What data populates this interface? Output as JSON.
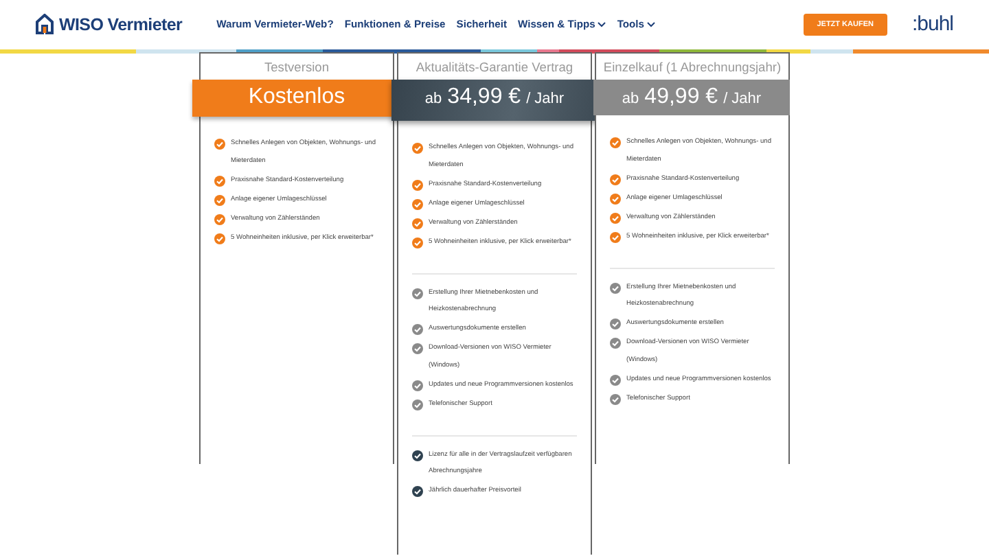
{
  "header": {
    "logo": "WISO Vermieter",
    "nav": [
      {
        "label": "Warum Vermieter-Web?",
        "dropdown": false
      },
      {
        "label": "Funktionen & Preise",
        "dropdown": false
      },
      {
        "label": "Sicherheit",
        "dropdown": false
      },
      {
        "label": "Wissen & Tipps",
        "dropdown": true
      },
      {
        "label": "Tools",
        "dropdown": true
      }
    ],
    "buy_button": "JETZT KAUFEN",
    "brand": ":buhl"
  },
  "plans": [
    {
      "title": "Testversion",
      "kind": "free",
      "price": [
        {
          "text": "Kostenlos",
          "kind": "big"
        }
      ],
      "groups": [
        {
          "kind": "basic",
          "items": [
            "Schnelles Anlegen von Objekten, Wohnungs- und Mieterdaten",
            "Praxisnahe Standard-Kostenverteilung",
            "Anlage eigener Umlageschlüssel",
            "Verwaltung von Zählerständen",
            "5 Wohneinheiten inklusive, per Klick erweiterbar*"
          ]
        }
      ]
    },
    {
      "title": "Aktualitäts-Garantie Vertrag",
      "kind": "featured",
      "price": [
        {
          "text": "ab",
          "kind": "small"
        },
        {
          "text": "34,99 €",
          "kind": "big"
        },
        {
          "text": "/ Jahr",
          "kind": "small"
        }
      ],
      "groups": [
        {
          "kind": "basic",
          "items": [
            "Schnelles Anlegen von Objekten, Wohnungs- und Mieterdaten",
            "Praxisnahe Standard-Kostenverteilung",
            "Anlage eigener Umlageschlüssel",
            "Verwaltung von Zählerständen",
            "5 Wohneinheiten inklusive, per Klick erweiterbar*"
          ]
        },
        {
          "kind": "extra",
          "items": [
            "Erstellung Ihrer Mietnebenkosten und Heizkostenabrechnung",
            "Auswertungsdokumente erstellen",
            "Download-Versionen von WISO Vermieter (Windows)",
            "Updates und neue Programmversionen kostenlos",
            "Telefonischer Support"
          ]
        },
        {
          "kind": "bonus",
          "items": [
            "Lizenz für alle in der Vertragslaufzeit verfügbaren Abrechnungsjahre",
            "Jährlich dauerhafter Preisvorteil"
          ]
        }
      ]
    },
    {
      "title": "Einzelkauf (1 Abrechnungsjahr)",
      "kind": "single",
      "price": [
        {
          "text": "ab",
          "kind": "small"
        },
        {
          "text": "49,99 €",
          "kind": "big"
        },
        {
          "text": "/ Jahr",
          "kind": "small"
        }
      ],
      "groups": [
        {
          "kind": "basic",
          "items": [
            "Schnelles Anlegen von Objekten, Wohnungs- und Mieterdaten",
            "Praxisnahe Standard-Kostenverteilung",
            "Anlage eigener Umlageschlüssel",
            "Verwaltung von Zählerständen",
            "5 Wohneinheiten inklusive, per Klick erweiterbar*"
          ]
        },
        {
          "kind": "extra",
          "items": [
            "Erstellung Ihrer Mietnebenkosten und Heizkostenabrechnung",
            "Auswertungsdokumente erstellen",
            "Download-Versionen von WISO Vermieter (Windows)",
            "Updates und neue Programmversionen kostenlos",
            "Telefonischer Support"
          ]
        }
      ]
    }
  ]
}
